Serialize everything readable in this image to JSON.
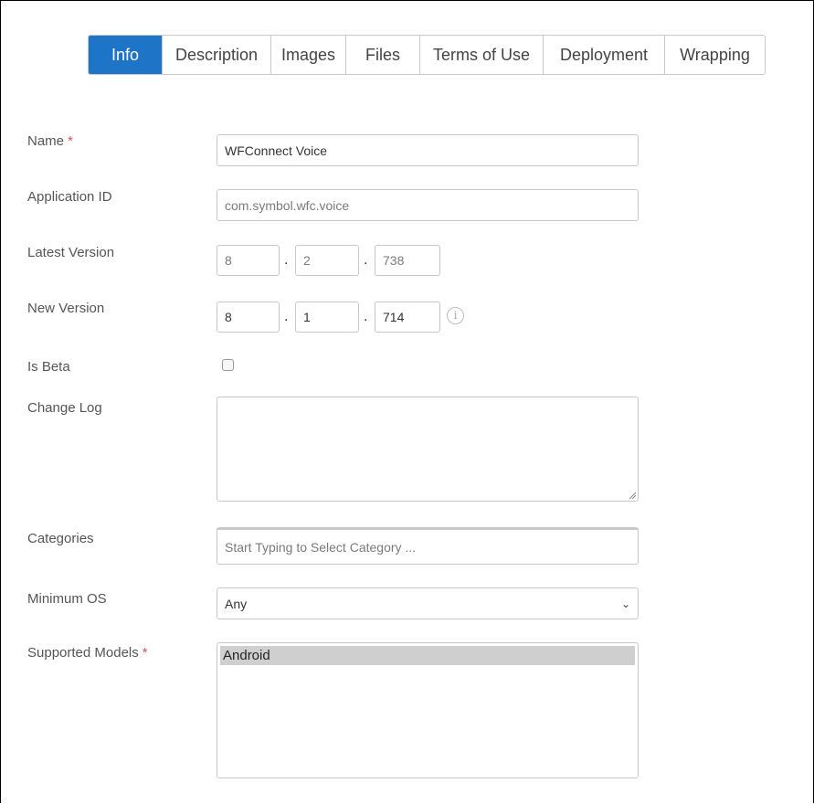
{
  "tabs": [
    {
      "label": "Info",
      "active": true
    },
    {
      "label": "Description"
    },
    {
      "label": "Images"
    },
    {
      "label": "Files"
    },
    {
      "label": "Terms of Use"
    },
    {
      "label": "Deployment"
    },
    {
      "label": "Wrapping"
    }
  ],
  "form": {
    "name": {
      "label": "Name",
      "value": "WFConnect Voice",
      "required": "*"
    },
    "application_id": {
      "label": "Application ID",
      "value": "com.symbol.wfc.voice"
    },
    "latest_version": {
      "label": "Latest Version",
      "major": "8",
      "minor": "2",
      "build": "738",
      "sep": "."
    },
    "new_version": {
      "label": "New Version",
      "major": "8",
      "minor": "1",
      "build": "714",
      "sep": ".",
      "info_icon": "info-icon"
    },
    "is_beta": {
      "label": "Is Beta",
      "checked": false
    },
    "change_log": {
      "label": "Change Log",
      "value": ""
    },
    "categories": {
      "label": "Categories",
      "placeholder": "Start Typing to Select Category ..."
    },
    "minimum_os": {
      "label": "Minimum OS",
      "value": "Any"
    },
    "supported_models": {
      "label": "Supported Models",
      "required": "*",
      "options": [
        "Android"
      ],
      "selected": "Android"
    }
  },
  "colors": {
    "accent": "#1e74c6",
    "required": "#d9534f"
  }
}
